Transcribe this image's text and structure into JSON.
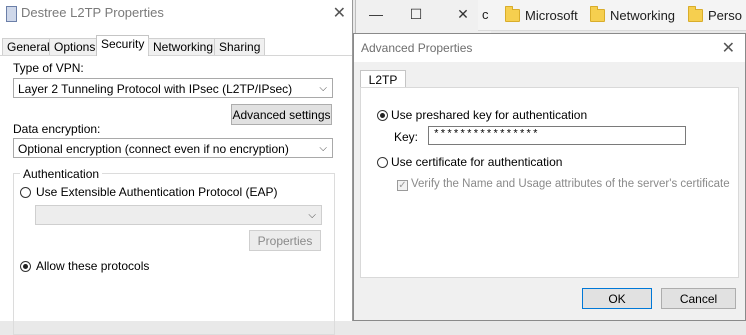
{
  "background_window": {
    "minimize_glyph": "—",
    "maximize_glyph": "☐",
    "close_glyph": "✕",
    "partial_text": "c"
  },
  "bookmarks": [
    {
      "label": "Microsoft",
      "icon": "folder-icon"
    },
    {
      "label": "Networking",
      "icon": "folder-icon"
    },
    {
      "label": "Perso",
      "icon": "folder-icon"
    }
  ],
  "props": {
    "title": "Destree L2TP Properties",
    "close_glyph": "✕",
    "tabs": [
      "General",
      "Options",
      "Security",
      "Networking",
      "Sharing"
    ],
    "active_tab": "Security",
    "vpn_type_label": "Type of VPN:",
    "vpn_type_value": "Layer 2 Tunneling Protocol with IPsec (L2TP/IPsec)",
    "advanced_button": "Advanced settings",
    "encryption_label": "Data encryption:",
    "encryption_value": "Optional encryption (connect even if no encryption)",
    "auth_group": "Authentication",
    "eap_label": "Use Extensible Authentication Protocol (EAP)",
    "eap_value": "",
    "properties_button": "Properties",
    "allow_label": "Allow these protocols",
    "dropdown_arrow": "⌵"
  },
  "advanced": {
    "title": "Advanced Properties",
    "close_glyph": "✕",
    "tab": "L2TP",
    "psk_label": "Use preshared key for authentication",
    "key_label": "Key:",
    "key_value": "****************",
    "cert_label": "Use certificate for authentication",
    "verify_label": "Verify the Name and Usage attributes of the server's certificate",
    "check_glyph": "✓",
    "ok_button": "OK",
    "cancel_button": "Cancel"
  }
}
